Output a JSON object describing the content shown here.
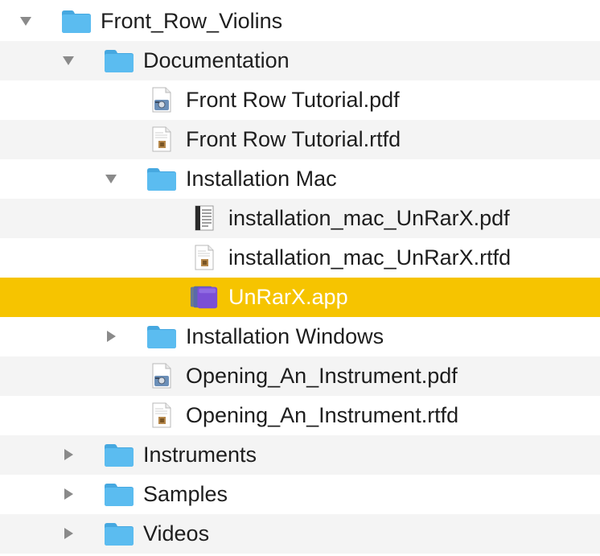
{
  "tree": {
    "rows": [
      {
        "label": "Front_Row_Violins",
        "kind": "folder",
        "disclosure": "expanded",
        "depth": 0
      },
      {
        "label": "Documentation",
        "kind": "folder",
        "disclosure": "expanded",
        "depth": 1
      },
      {
        "label": "Front Row Tutorial.pdf",
        "kind": "pdf-preview",
        "disclosure": "none",
        "depth": 2
      },
      {
        "label": "Front Row Tutorial.rtfd",
        "kind": "rtfd",
        "disclosure": "none",
        "depth": 2
      },
      {
        "label": "Installation Mac",
        "kind": "folder",
        "disclosure": "expanded",
        "depth": 2
      },
      {
        "label": "installation_mac_UnRarX.pdf",
        "kind": "pdf-doc",
        "disclosure": "none",
        "depth": 3
      },
      {
        "label": "installation_mac_UnRarX.rtfd",
        "kind": "rtfd",
        "disclosure": "none",
        "depth": 3
      },
      {
        "label": "UnRarX.app",
        "kind": "app",
        "disclosure": "none",
        "depth": 3,
        "selected": true
      },
      {
        "label": "Installation Windows",
        "kind": "folder",
        "disclosure": "collapsed",
        "depth": 2
      },
      {
        "label": "Opening_An_Instrument.pdf",
        "kind": "pdf-preview",
        "disclosure": "none",
        "depth": 2
      },
      {
        "label": "Opening_An_Instrument.rtfd",
        "kind": "rtfd",
        "disclosure": "none",
        "depth": 2
      },
      {
        "label": "Instruments",
        "kind": "folder",
        "disclosure": "collapsed",
        "depth": 1
      },
      {
        "label": "Samples",
        "kind": "folder",
        "disclosure": "collapsed",
        "depth": 1
      },
      {
        "label": "Videos",
        "kind": "folder",
        "disclosure": "collapsed",
        "depth": 1
      }
    ]
  },
  "colors": {
    "selection": "#f6c400",
    "alternate_row": "#f4f4f4",
    "folder": "#5bbcf0",
    "folder_tab": "#46a8e0",
    "disclosure": "#8a8a8a",
    "app_icon": "#7b4fd6"
  }
}
